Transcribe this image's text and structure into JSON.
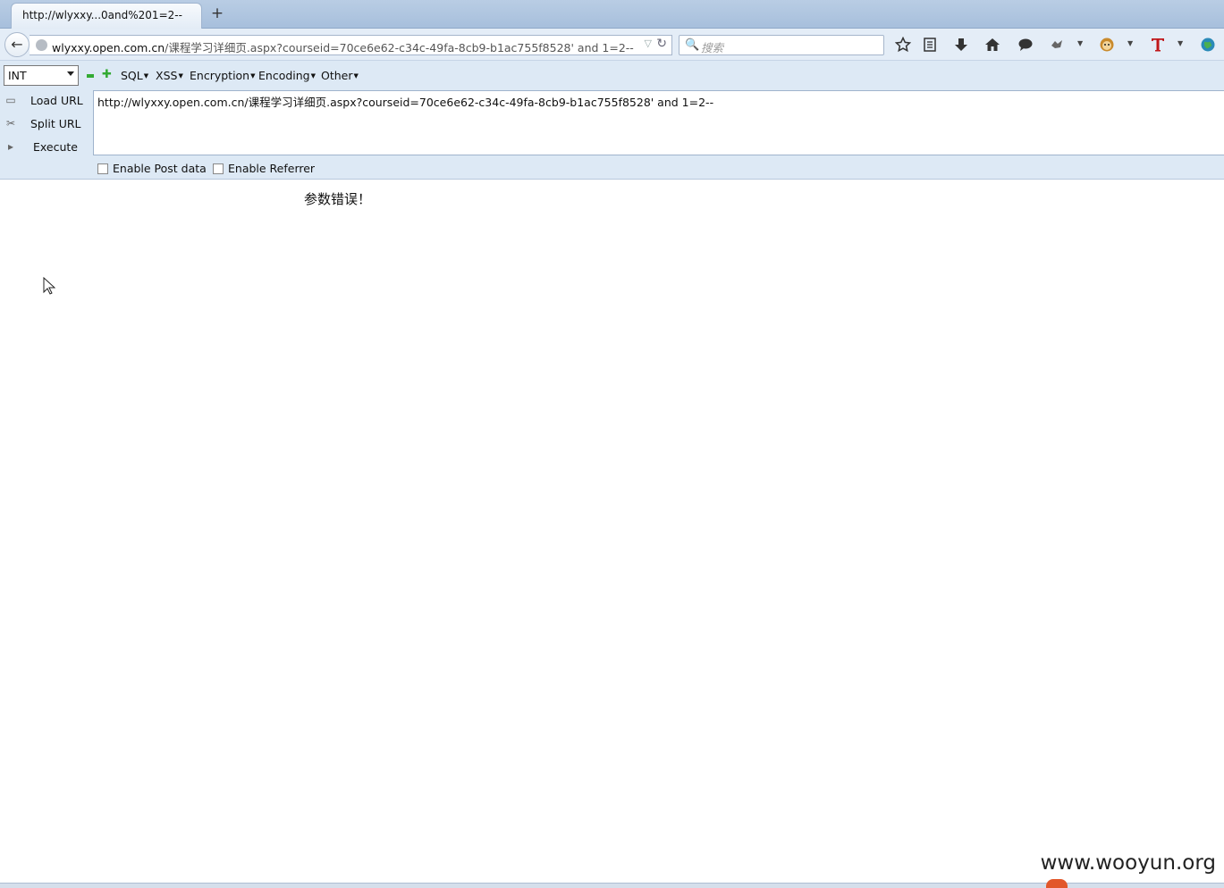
{
  "tab": {
    "title": "http://wlyxxy...0and%201=2--",
    "new_tab": "+"
  },
  "nav": {
    "back": "←",
    "url_host": "wlyxxy.open.com.cn",
    "url_path": "/课程学习详细页.aspx?courseid=70ce6e62-c34c-49fa-8cb9-b1ac755f8528' and 1=2--",
    "url_drop": "▽",
    "url_reload": "↻",
    "search_placeholder": "搜索",
    "search_icon": "🔍"
  },
  "toolbar_icons": [
    "star-icon",
    "reading-list-icon",
    "download-icon",
    "home-icon",
    "chat-icon",
    "extension-icon",
    "monkey-icon",
    "text-icon",
    "globe-icon"
  ],
  "hackbar": {
    "select_value": "INT",
    "menus": [
      "SQL",
      "XSS",
      "Encryption",
      "Encoding",
      "Other"
    ],
    "buttons": {
      "load": "Load URL",
      "split": "Split URL",
      "execute": "Execute"
    },
    "url": "http://wlyxxy.open.com.cn/课程学习详细页.aspx?courseid=70ce6e62-c34c-49fa-8cb9-b1ac755f8528' and 1=2--",
    "checks": {
      "post": "Enable Post data",
      "referrer": "Enable Referrer"
    }
  },
  "page": {
    "message": "参数错误！"
  },
  "watermark": "www.wooyun.org",
  "colors": {
    "accent": "#dde9f5",
    "tab_bg": "#b9cde4"
  }
}
